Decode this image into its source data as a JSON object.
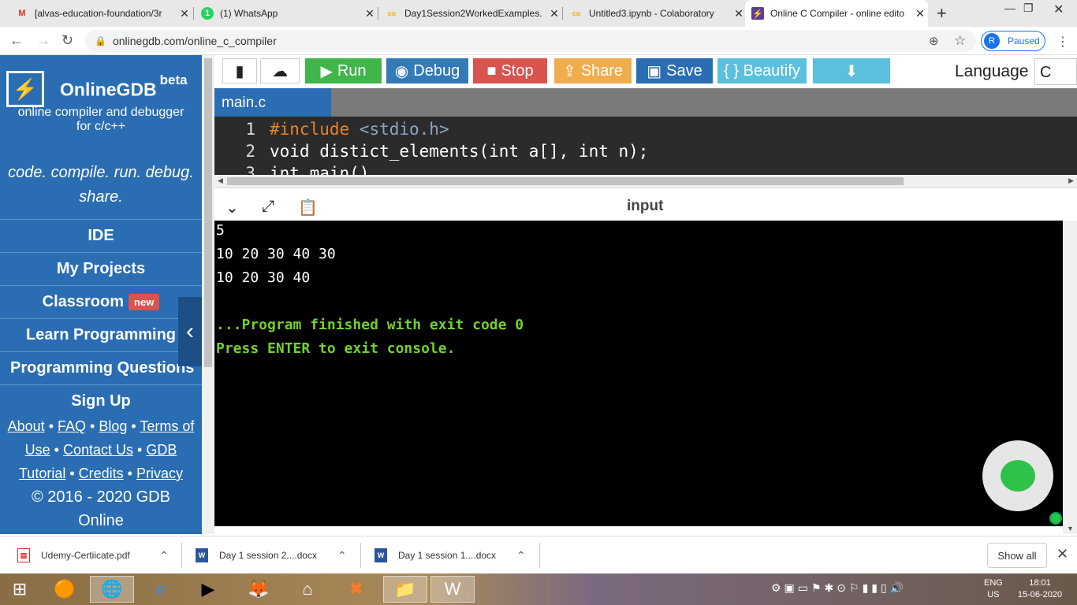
{
  "browser": {
    "tabs": [
      {
        "title": "[alvas-education-foundation/3r",
        "icon": "gmail-icon",
        "icon_glyph": "M",
        "icon_color": "#d93025"
      },
      {
        "title": "(1) WhatsApp",
        "icon": "whatsapp-icon",
        "icon_glyph": "1",
        "icon_color": "#25d366"
      },
      {
        "title": "Day1Session2WorkedExamples.",
        "icon": "colab-icon",
        "icon_glyph": "co",
        "icon_color": "#f9ab00"
      },
      {
        "title": "Untitled3.ipynb - Colaboratory",
        "icon": "colab-icon",
        "icon_glyph": "co",
        "icon_color": "#f9ab00"
      },
      {
        "title": "Online C Compiler - online edito",
        "icon": "onlinegdb-icon",
        "icon_glyph": "⚡",
        "icon_color": "#5c3d99"
      }
    ],
    "new_tab": "+",
    "url": "onlinegdb.com/online_c_compiler",
    "profile_initial": "R",
    "profile_status": "Paused"
  },
  "sidebar": {
    "brand": "OnlineGDB",
    "beta": "beta",
    "tagline_line1": "online compiler and debugger",
    "tagline_line2": "for c/c++",
    "motto_line1": "code. compile. run. debug.",
    "motto_line2": "share.",
    "menu": [
      {
        "label": "IDE"
      },
      {
        "label": "My Projects"
      },
      {
        "label": "Classroom",
        "badge": "new"
      },
      {
        "label": "Learn Programming"
      },
      {
        "label": "Programming Questions"
      },
      {
        "label": "Sign Up"
      }
    ],
    "footer": {
      "about": "About",
      "faq": "FAQ",
      "blog": "Blog",
      "terms_a": "Terms of",
      "terms_b": "Use",
      "contact": "Contact Us",
      "gdb_a": "GDB",
      "gdb_b": "Tutorial",
      "credits": "Credits",
      "privacy": "Privacy",
      "copyright_a": "© 2016 - 2020 GDB",
      "copyright_b": "Online"
    }
  },
  "toolbar": {
    "run": "Run",
    "debug": "Debug",
    "stop": "Stop",
    "share": "Share",
    "save": "Save",
    "beautify": "{ } Beautify",
    "language_label": "Language",
    "language_value": "C",
    "colors": {
      "run": "#3fb54a",
      "debug": "#337ab7",
      "stop": "#d9534f",
      "share": "#f0ad4e",
      "save": "#2a6db2",
      "beautify": "#5bc0de",
      "download": "#5bc0de"
    }
  },
  "editor": {
    "file_tab": "main.c",
    "lines": [
      {
        "num": "1",
        "pp": "#include",
        "hdr": " <stdio.h>"
      },
      {
        "num": "2",
        "text": "void distict_elements(int a[], int n);"
      },
      {
        "num": "3",
        "text": "int main()"
      }
    ]
  },
  "io": {
    "title": "input",
    "output_lines": [
      "5",
      "10 20 30 40 30",
      "10 20 30 40"
    ],
    "status_lines": [
      "...Program finished with exit code 0",
      "Press ENTER to exit console."
    ]
  },
  "downloads": {
    "items": [
      {
        "name": "Udemy-Certiicate.pdf",
        "icon": "pdf-icon"
      },
      {
        "name": "Day 1 session 2....docx",
        "icon": "word-doc-icon"
      },
      {
        "name": "Day 1 session 1....docx",
        "icon": "word-doc-icon"
      }
    ],
    "show_all": "Show all"
  },
  "taskbar": {
    "lang_a": "ENG",
    "lang_b": "US",
    "time": "18:01",
    "date": "15-06-2020"
  }
}
